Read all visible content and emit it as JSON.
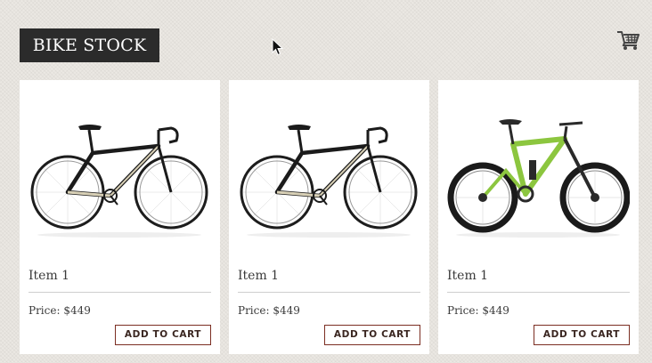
{
  "header": {
    "logo_text": "BIKE STOCK",
    "cart_icon": "shopping-cart-icon"
  },
  "products": [
    {
      "name": "Item 1",
      "price": "Price: $449",
      "button_label": "ADD TO CART",
      "image": "road-bike-black"
    },
    {
      "name": "Item 1",
      "price": "Price: $449",
      "button_label": "ADD TO CART",
      "image": "road-bike-black"
    },
    {
      "name": "Item 1",
      "price": "Price: $449",
      "button_label": "ADD TO CART",
      "image": "mountain-bike-green"
    }
  ],
  "colors": {
    "logo_bg": "#2b2b2b",
    "button_border": "#7b2e22",
    "page_bg": "#ebe8e3"
  }
}
